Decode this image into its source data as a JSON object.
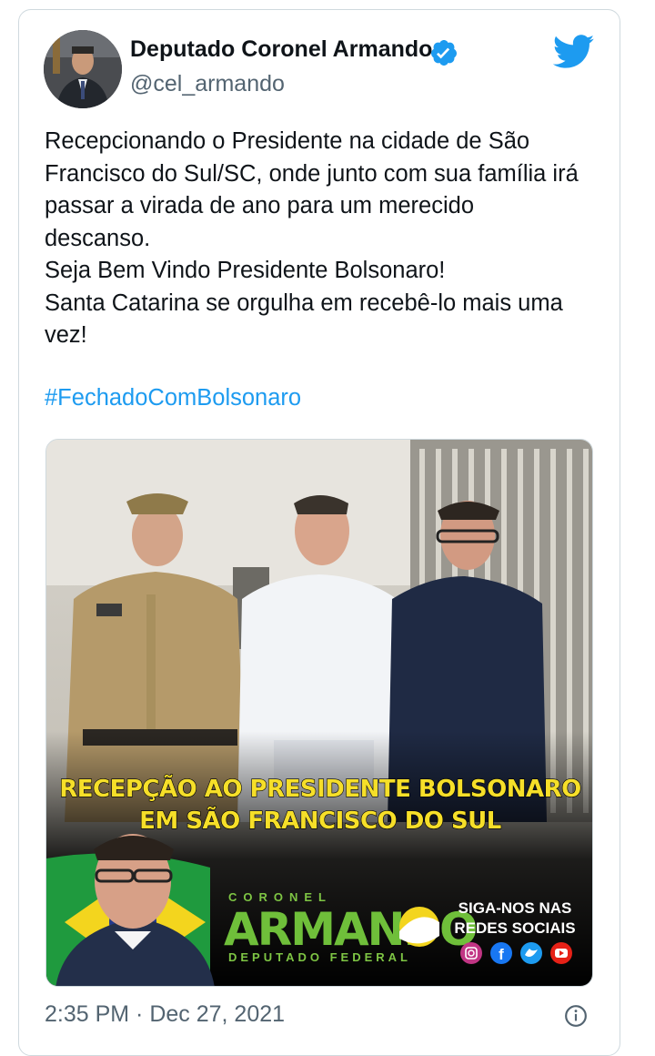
{
  "author": {
    "name": "Deputado Coronel Armando",
    "handle": "@cel_armando"
  },
  "tweet": {
    "lines": [
      "Recepcionando o Presidente na cidade de São",
      "Francisco do Sul/SC, onde junto com sua família irá",
      "passar a virada de ano para um merecido",
      "descanso.",
      "Seja Bem Vindo Presidente Bolsonaro!",
      "Santa Catarina se orgulha em recebê-lo mais uma",
      "vez!"
    ],
    "hashtag": "#FechadoComBolsonaro"
  },
  "media": {
    "headline_1": "RECEPÇÃO AO PRESIDENTE BOLSONARO",
    "headline_2": "EM SÃO FRANCISCO DO SUL",
    "brand_top": "CORONEL",
    "brand_main": "ARMANDO",
    "brand_bottom": "DEPUTADO FEDERAL",
    "social_1": "SIGA-NOS NAS",
    "social_2": "REDES SOCIAIS"
  },
  "timestamp": "2:35 PM · Dec 27, 2021",
  "icons": {
    "verified": "verified-badge-icon",
    "twitter": "twitter-bird-icon",
    "info": "info-icon"
  },
  "colors": {
    "accent": "#1d9bf0",
    "text": "#0f1419",
    "secondary": "#536471",
    "banner_yellow": "#f6df29",
    "brand_green": "#6fbf3a"
  }
}
